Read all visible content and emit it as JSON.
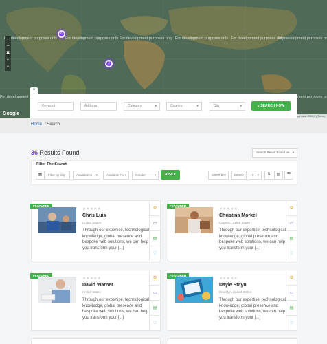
{
  "map": {
    "watermark": "For development purposes only",
    "clusters": [
      "6",
      "3"
    ],
    "controls": [
      "+",
      "−",
      "✖",
      "•",
      "•"
    ],
    "google_label": "Google",
    "terms": "Map data ©2024 | Terms",
    "toggle": "^"
  },
  "search": {
    "keyword_placeholder": "Keyword",
    "address_placeholder": "Address",
    "category_label": "Category",
    "country_label": "Country",
    "city_label": "City",
    "button_label": "SEARCH NOW"
  },
  "breadcrumb": {
    "home": "Home",
    "current": "/ Search"
  },
  "results": {
    "count": "36",
    "label": " Results Found",
    "sort_placeholder": "Search Result Based on"
  },
  "filter": {
    "title": "Filter The Search",
    "city_placeholder": "Filter by City",
    "available_in": "Available In",
    "available_for": "Available For",
    "gender": "Gender",
    "apply_label": "APPLY",
    "sort_by": "SORT BY",
    "order": "DESC",
    "per_page": "9"
  },
  "cards": [
    {
      "badge": "FEATURED",
      "stars": "★★★★★",
      "name": "Chris Luis",
      "location": "United States",
      "description": "Through our expertise, technological knowledge, global presence and bespoke web solutions, we can help you transform your [...]"
    },
    {
      "badge": "FEATURED",
      "stars": "★★★★★",
      "name": "Christina Morkel",
      "location": "Queens, United States",
      "description": "Through our expertise, technological knowledge, global presence and bespoke web solutions, we can help you transform your [...]"
    },
    {
      "badge": "FEATURED",
      "stars": "★★★★★",
      "name": "David Warner",
      "location": "United States",
      "description": "Through our expertise, technological knowledge, global presence and bespoke web solutions, we can help you transform your [...]"
    },
    {
      "badge": "FEATURED",
      "stars": "★★★★★",
      "name": "Dayle Stayn",
      "location": "Brooklyn, United States",
      "description": "Through our expertise, technological knowledge, global presence and bespoke web solutions, we can help you transform your [...]"
    }
  ],
  "colors": {
    "accent_green": "#46b04a",
    "accent_purple": "#7b3fe4",
    "link_blue": "#2a6cc7"
  },
  "icons": [
    "search-icon",
    "calendar-icon",
    "grid-icon",
    "list-icon",
    "award-icon",
    "chat-icon",
    "document-icon",
    "heart-icon"
  ]
}
